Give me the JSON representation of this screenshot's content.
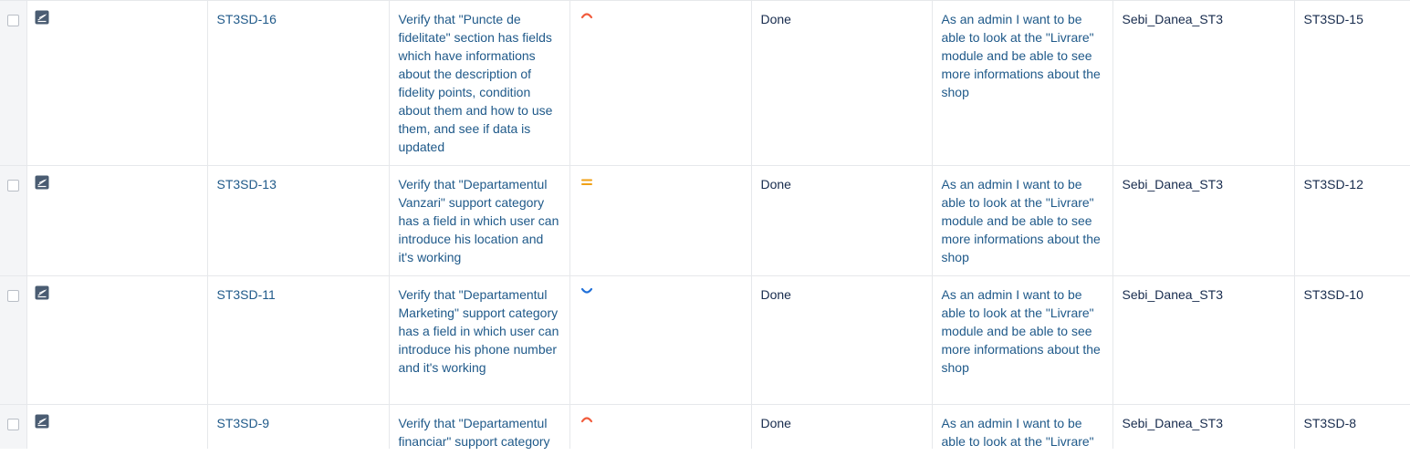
{
  "colors": {
    "priority_high": "#f15c3d",
    "priority_medium": "#f0a116",
    "priority_low": "#1f6fd8",
    "link": "#205a8a",
    "type_icon": "#4a5c72"
  },
  "rows": [
    {
      "type_icon": "test-issue-icon",
      "key": "ST3SD-16",
      "summary": "Verify that \"Puncte de fidelitate\" section has fields which have informations about the description of fidelity points, condition about them and how to use them, and see if data is updated",
      "priority": "high",
      "status": "Done",
      "story": "As an admin I want to be able to look at the \"Livrare\" module and be able to see more informations about the shop",
      "assignee": "Sebi_Danea_ST3",
      "linked_key": "ST3SD-15"
    },
    {
      "type_icon": "test-issue-icon",
      "key": "ST3SD-13",
      "summary": "Verify that \"Departamentul Vanzari\" support category has a field in which user can introduce his location and it's working",
      "priority": "medium",
      "status": "Done",
      "story": "As an admin I want to be able to look at the \"Livrare\" module and be able to see more informations about the shop",
      "assignee": "Sebi_Danea_ST3",
      "linked_key": "ST3SD-12"
    },
    {
      "type_icon": "test-issue-icon",
      "key": "ST3SD-11",
      "summary": "Verify that \"Departamentul Marketing\" support category has a field in which user can introduce his phone number and it's working",
      "priority": "low",
      "status": "Done",
      "story": "As an admin I want to be able to look at the \"Livrare\" module and be able to see more informations about the shop",
      "assignee": "Sebi_Danea_ST3",
      "linked_key": "ST3SD-10"
    },
    {
      "type_icon": "test-issue-icon",
      "key": "ST3SD-9",
      "summary": "Verify that \"Departamentul financiar\" support category",
      "priority": "high",
      "status": "Done",
      "story": "As an admin I want to be able to look at the \"Livrare\"",
      "assignee": "Sebi_Danea_ST3",
      "linked_key": "ST3SD-8"
    }
  ]
}
